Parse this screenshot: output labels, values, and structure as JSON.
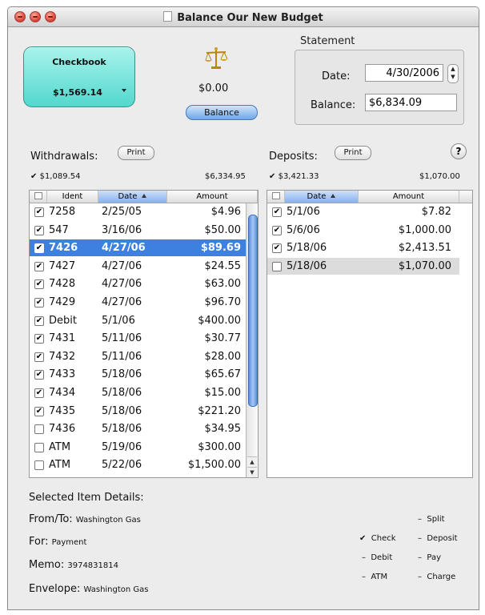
{
  "window": {
    "title": "Balance Our New Budget"
  },
  "checkbook": {
    "name": "Checkbook",
    "balance": "$1,569.14"
  },
  "balance": {
    "amount": "$0.00",
    "button_label": "Balance"
  },
  "statement": {
    "label": "Statement",
    "date_label": "Date:",
    "date_value": "4/30/2006",
    "balance_label": "Balance:",
    "balance_value": "$6,834.09"
  },
  "withdrawals": {
    "label": "Withdrawals:",
    "print_label": "Print",
    "checked_total": "$1,089.54",
    "unchecked_total": "$6,334.95",
    "columns": {
      "ident": "Ident",
      "date": "Date",
      "amount": "Amount"
    },
    "rows": [
      {
        "checked": true,
        "ident": "7258",
        "date": "2/25/05",
        "amount": "$4.96"
      },
      {
        "checked": true,
        "ident": "547",
        "date": "3/16/06",
        "amount": "$50.00"
      },
      {
        "checked": true,
        "ident": "7426",
        "date": "4/27/06",
        "amount": "$89.69",
        "selected": true
      },
      {
        "checked": true,
        "ident": "7427",
        "date": "4/27/06",
        "amount": "$24.55"
      },
      {
        "checked": true,
        "ident": "7428",
        "date": "4/27/06",
        "amount": "$63.00"
      },
      {
        "checked": true,
        "ident": "7429",
        "date": "4/27/06",
        "amount": "$96.70"
      },
      {
        "checked": true,
        "ident": "Debit",
        "date": "5/1/06",
        "amount": "$400.00"
      },
      {
        "checked": true,
        "ident": "7431",
        "date": "5/11/06",
        "amount": "$30.77"
      },
      {
        "checked": true,
        "ident": "7432",
        "date": "5/11/06",
        "amount": "$28.00"
      },
      {
        "checked": true,
        "ident": "7433",
        "date": "5/18/06",
        "amount": "$65.67"
      },
      {
        "checked": true,
        "ident": "7434",
        "date": "5/18/06",
        "amount": "$15.00"
      },
      {
        "checked": true,
        "ident": "7435",
        "date": "5/18/06",
        "amount": "$221.20"
      },
      {
        "checked": false,
        "ident": "7436",
        "date": "5/18/06",
        "amount": "$34.95"
      },
      {
        "checked": false,
        "ident": "ATM",
        "date": "5/19/06",
        "amount": "$300.00"
      },
      {
        "checked": false,
        "ident": "ATM",
        "date": "5/22/06",
        "amount": "$1,500.00"
      }
    ]
  },
  "deposits": {
    "label": "Deposits:",
    "print_label": "Print",
    "checked_total": "$3,421.33",
    "unchecked_total": "$1,070.00",
    "columns": {
      "date": "Date",
      "amount": "Amount"
    },
    "rows": [
      {
        "checked": true,
        "date": "5/1/06",
        "amount": "$7.82"
      },
      {
        "checked": true,
        "date": "5/6/06",
        "amount": "$1,000.00"
      },
      {
        "checked": true,
        "date": "5/18/06",
        "amount": "$2,413.51"
      },
      {
        "checked": false,
        "date": "5/18/06",
        "amount": "$1,070.00",
        "highlighted": true
      }
    ]
  },
  "help": {
    "label": "?"
  },
  "details": {
    "title": "Selected Item Details:",
    "from_to_label": "From/To:",
    "from_to_value": "Washington Gas",
    "for_label": "For:",
    "for_value": "Payment",
    "memo_label": "Memo:",
    "memo_value": "3974831814",
    "envelope_label": "Envelope:",
    "envelope_value": "Washington Gas"
  },
  "types": {
    "split": "Split",
    "check": "Check",
    "deposit": "Deposit",
    "debit": "Debit",
    "pay": "Pay",
    "atm": "ATM",
    "charge": "Charge",
    "selected": "check"
  },
  "glyphs": {
    "check": "✔",
    "dash": "–"
  },
  "colors": {
    "selection": "#3d80df",
    "checkbook_top": "#a9f3ec",
    "checkbook_bottom": "#52d8ce"
  }
}
